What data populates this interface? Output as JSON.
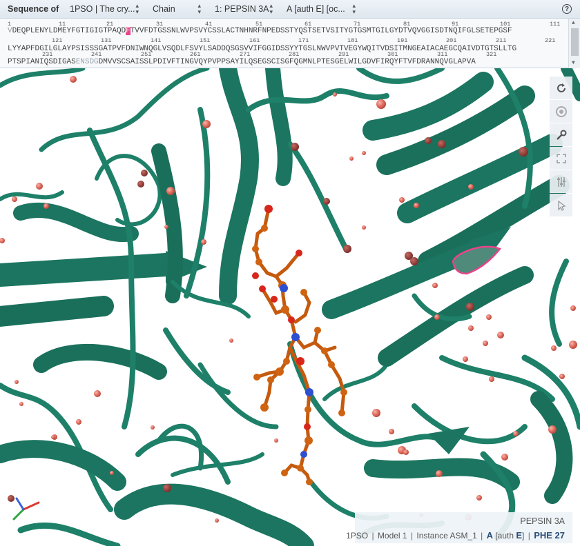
{
  "topbar": {
    "label": "Sequence of",
    "entry_select": "1PSO | The cry...",
    "mode_select": "Chain",
    "chain_select": "1: PEPSIN 3A",
    "auth_select": "A [auth E] [oc..."
  },
  "sequence": {
    "numbers_row1": [
      "1",
      "11",
      "21",
      "31",
      "41",
      "51",
      "61",
      "71",
      "81",
      "91",
      "101",
      "111"
    ],
    "row1_a": "V",
    "row1_b": "DEQPLENYLDMEYFGTIGIGTPAQD",
    "row1_hl": "F",
    "row1_c": "TVVFDTGSSNLWVPSVYCSSLACTNHNRFNPEDSSTYQSTSETVSITYGTGSMTGILGYDTVQVGGISDTNQIFGLSETEPGSF",
    "numbers_row2": [
      "121",
      "131",
      "141",
      "151",
      "161",
      "171",
      "181",
      "191",
      "201",
      "211",
      "221"
    ],
    "row2": "LYYAPFDGILGLAYPSISSSGATPVFDNIWNQGLVSQDLFSVYLSADDQSGSVVIFGGIDSSYYTGSLNWVPVTVEGYWQITVDSITMNGEAIACAEGCQAIVDTGTSLLTG",
    "numbers_row3": [
      "231",
      "241",
      "251",
      "261",
      "271",
      "281",
      "291",
      "301",
      "311",
      "321"
    ],
    "row3_a": "PTSPIANIQSDIGAS",
    "row3_faint": "ENSDG",
    "row3_b": "DMVVSCSAISSLPDIVFTINGVQYPVPPSAYILQSEGSCISGFQGMNLPTESGELWILGDVFIRQYFTVFDRANNQVGLAPVA"
  },
  "info": {
    "molecule": "PEPSIN 3A",
    "entry": "1PSO",
    "model": "Model 1",
    "instance": "Instance ASM_1",
    "chain": "A",
    "auth_prefix": "[auth",
    "auth_chain": "E",
    "auth_suffix": "]",
    "residue": "PHE 27"
  },
  "icons": {
    "dropdown": "triangle-updown-icon",
    "help": "question-circle-icon",
    "reset": "refresh-icon",
    "screenshot": "camera-aperture-icon",
    "settings": "wrench-icon",
    "expand": "expand-icon",
    "controls": "sliders-icon",
    "select_mode": "cursor-arrow-icon"
  },
  "colors": {
    "protein": "#1e8068",
    "ligand": "#c55a0e",
    "water": "#e06a5c",
    "highlight": "#e8448a",
    "accent": "#2a4d7a"
  }
}
